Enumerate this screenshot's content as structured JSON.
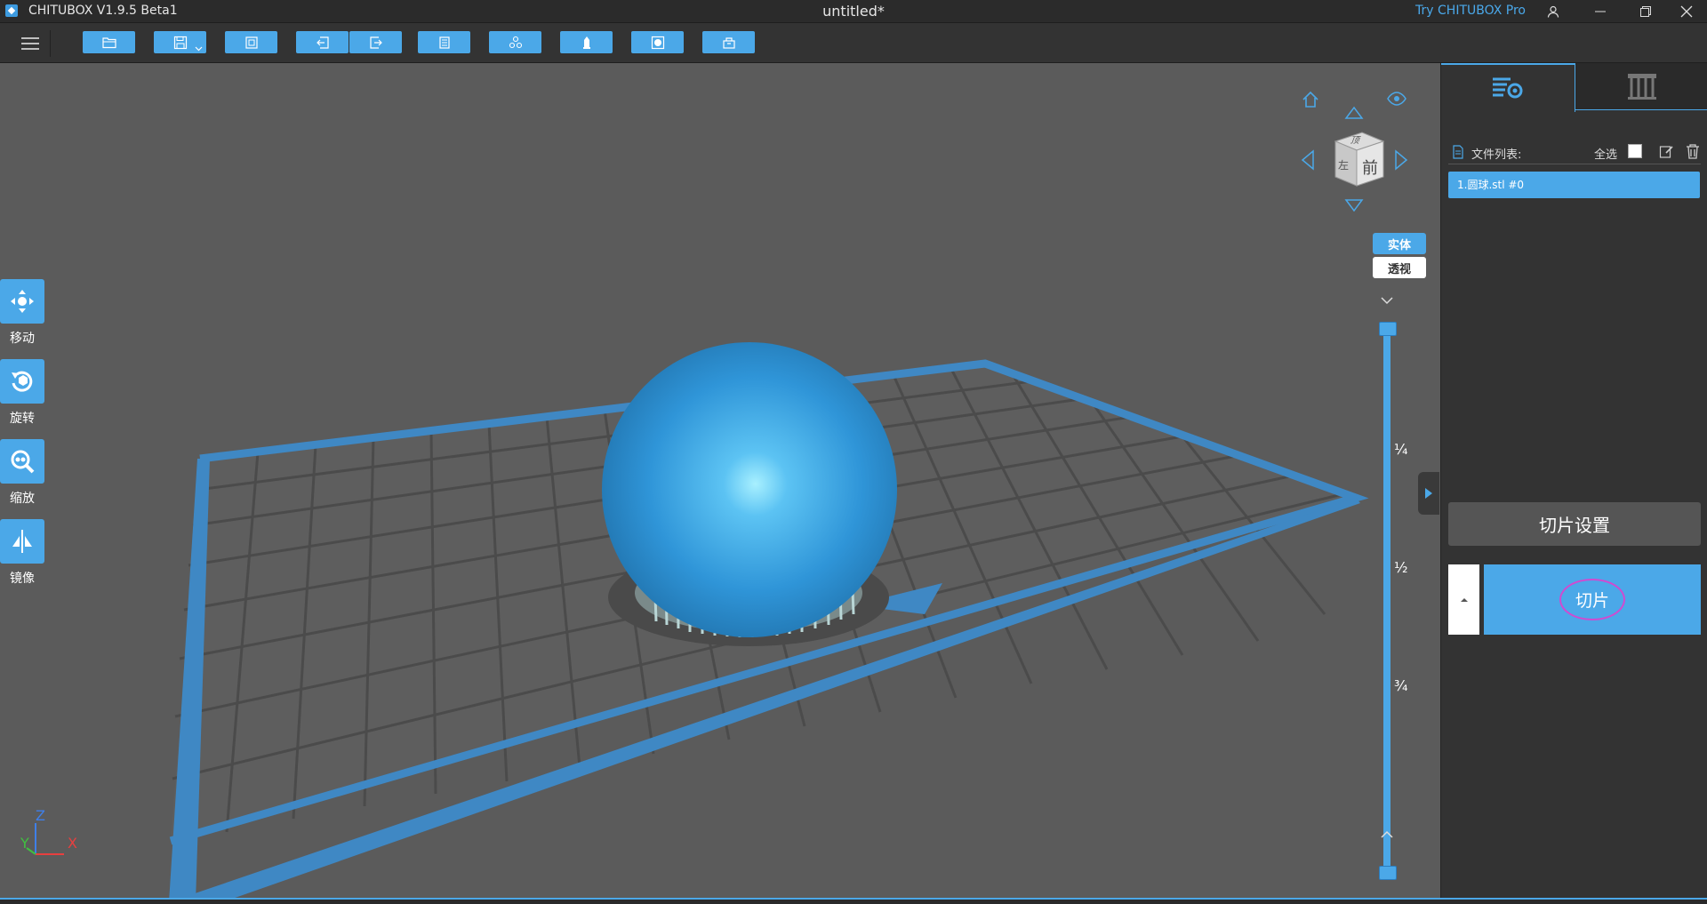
{
  "titlebar": {
    "app_name": "CHITUBOX V1.9.5 Beta1",
    "doc_title": "untitled*",
    "try_pro": "Try CHITUBOX Pro"
  },
  "toolbar": {
    "icons": [
      "open-file-icon",
      "save-icon",
      "save-dropdown-icon",
      "screenshot-icon",
      "undo-icon",
      "redo-icon",
      "copy-icon",
      "multi-object-icon",
      "support-icon",
      "hollow-icon",
      "tray-icon"
    ]
  },
  "left_tools": {
    "move_label": "移动",
    "rotate_label": "旋转",
    "scale_label": "缩放",
    "mirror_label": "镜像"
  },
  "view_cube": {
    "front_label": "前",
    "top_label": "顶",
    "side_label": "左"
  },
  "view_mode": {
    "solid": "实体",
    "perspective": "透视"
  },
  "layer_slider": {
    "mark_quarter": "¼",
    "mark_half": "½",
    "mark_three_quarters": "¾"
  },
  "axes": {
    "z": "Z",
    "y": "Y",
    "x": "X"
  },
  "right_panel": {
    "file_list_label": "文件列表:",
    "select_all_label": "全选",
    "files": [
      "1.圆球.stl #0"
    ],
    "slice_settings_label": "切片设置",
    "slice_label": "切片"
  },
  "colors": {
    "accent": "#4ba8e8",
    "viewport_bg": "#5b5b5b",
    "panel_bg": "#333333",
    "model": "#2f95d8"
  }
}
